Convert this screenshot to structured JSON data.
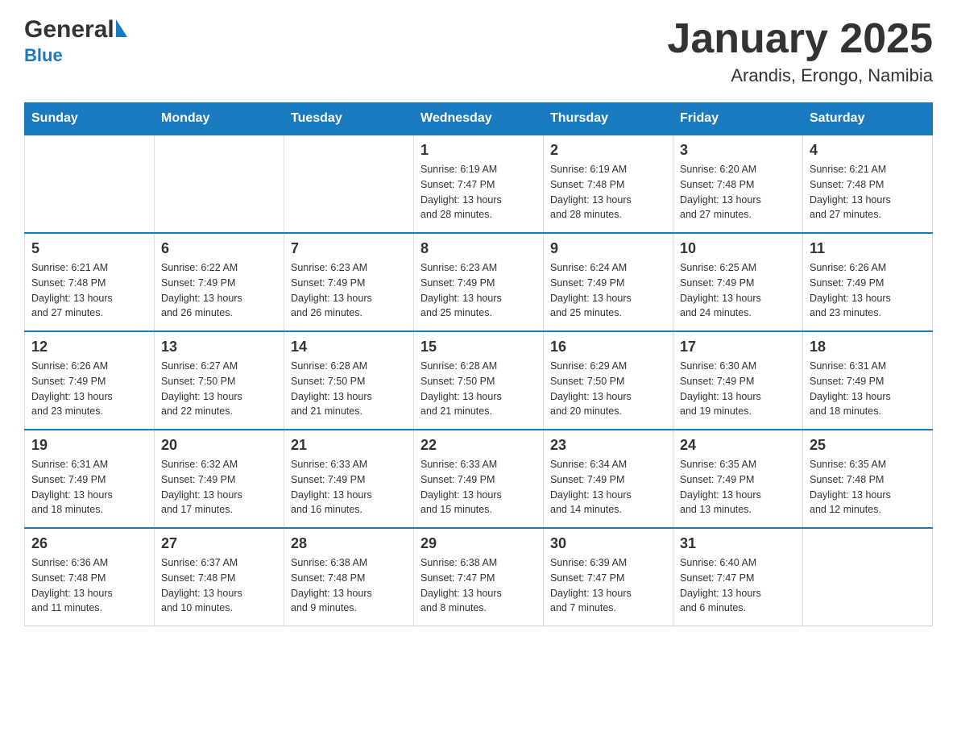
{
  "header": {
    "logo_general": "General",
    "logo_blue": "Blue",
    "title": "January 2025",
    "subtitle": "Arandis, Erongo, Namibia"
  },
  "columns": [
    "Sunday",
    "Monday",
    "Tuesday",
    "Wednesday",
    "Thursday",
    "Friday",
    "Saturday"
  ],
  "rows": [
    [
      {
        "day": "",
        "info": ""
      },
      {
        "day": "",
        "info": ""
      },
      {
        "day": "",
        "info": ""
      },
      {
        "day": "1",
        "info": "Sunrise: 6:19 AM\nSunset: 7:47 PM\nDaylight: 13 hours\nand 28 minutes."
      },
      {
        "day": "2",
        "info": "Sunrise: 6:19 AM\nSunset: 7:48 PM\nDaylight: 13 hours\nand 28 minutes."
      },
      {
        "day": "3",
        "info": "Sunrise: 6:20 AM\nSunset: 7:48 PM\nDaylight: 13 hours\nand 27 minutes."
      },
      {
        "day": "4",
        "info": "Sunrise: 6:21 AM\nSunset: 7:48 PM\nDaylight: 13 hours\nand 27 minutes."
      }
    ],
    [
      {
        "day": "5",
        "info": "Sunrise: 6:21 AM\nSunset: 7:48 PM\nDaylight: 13 hours\nand 27 minutes."
      },
      {
        "day": "6",
        "info": "Sunrise: 6:22 AM\nSunset: 7:49 PM\nDaylight: 13 hours\nand 26 minutes."
      },
      {
        "day": "7",
        "info": "Sunrise: 6:23 AM\nSunset: 7:49 PM\nDaylight: 13 hours\nand 26 minutes."
      },
      {
        "day": "8",
        "info": "Sunrise: 6:23 AM\nSunset: 7:49 PM\nDaylight: 13 hours\nand 25 minutes."
      },
      {
        "day": "9",
        "info": "Sunrise: 6:24 AM\nSunset: 7:49 PM\nDaylight: 13 hours\nand 25 minutes."
      },
      {
        "day": "10",
        "info": "Sunrise: 6:25 AM\nSunset: 7:49 PM\nDaylight: 13 hours\nand 24 minutes."
      },
      {
        "day": "11",
        "info": "Sunrise: 6:26 AM\nSunset: 7:49 PM\nDaylight: 13 hours\nand 23 minutes."
      }
    ],
    [
      {
        "day": "12",
        "info": "Sunrise: 6:26 AM\nSunset: 7:49 PM\nDaylight: 13 hours\nand 23 minutes."
      },
      {
        "day": "13",
        "info": "Sunrise: 6:27 AM\nSunset: 7:50 PM\nDaylight: 13 hours\nand 22 minutes."
      },
      {
        "day": "14",
        "info": "Sunrise: 6:28 AM\nSunset: 7:50 PM\nDaylight: 13 hours\nand 21 minutes."
      },
      {
        "day": "15",
        "info": "Sunrise: 6:28 AM\nSunset: 7:50 PM\nDaylight: 13 hours\nand 21 minutes."
      },
      {
        "day": "16",
        "info": "Sunrise: 6:29 AM\nSunset: 7:50 PM\nDaylight: 13 hours\nand 20 minutes."
      },
      {
        "day": "17",
        "info": "Sunrise: 6:30 AM\nSunset: 7:49 PM\nDaylight: 13 hours\nand 19 minutes."
      },
      {
        "day": "18",
        "info": "Sunrise: 6:31 AM\nSunset: 7:49 PM\nDaylight: 13 hours\nand 18 minutes."
      }
    ],
    [
      {
        "day": "19",
        "info": "Sunrise: 6:31 AM\nSunset: 7:49 PM\nDaylight: 13 hours\nand 18 minutes."
      },
      {
        "day": "20",
        "info": "Sunrise: 6:32 AM\nSunset: 7:49 PM\nDaylight: 13 hours\nand 17 minutes."
      },
      {
        "day": "21",
        "info": "Sunrise: 6:33 AM\nSunset: 7:49 PM\nDaylight: 13 hours\nand 16 minutes."
      },
      {
        "day": "22",
        "info": "Sunrise: 6:33 AM\nSunset: 7:49 PM\nDaylight: 13 hours\nand 15 minutes."
      },
      {
        "day": "23",
        "info": "Sunrise: 6:34 AM\nSunset: 7:49 PM\nDaylight: 13 hours\nand 14 minutes."
      },
      {
        "day": "24",
        "info": "Sunrise: 6:35 AM\nSunset: 7:49 PM\nDaylight: 13 hours\nand 13 minutes."
      },
      {
        "day": "25",
        "info": "Sunrise: 6:35 AM\nSunset: 7:48 PM\nDaylight: 13 hours\nand 12 minutes."
      }
    ],
    [
      {
        "day": "26",
        "info": "Sunrise: 6:36 AM\nSunset: 7:48 PM\nDaylight: 13 hours\nand 11 minutes."
      },
      {
        "day": "27",
        "info": "Sunrise: 6:37 AM\nSunset: 7:48 PM\nDaylight: 13 hours\nand 10 minutes."
      },
      {
        "day": "28",
        "info": "Sunrise: 6:38 AM\nSunset: 7:48 PM\nDaylight: 13 hours\nand 9 minutes."
      },
      {
        "day": "29",
        "info": "Sunrise: 6:38 AM\nSunset: 7:47 PM\nDaylight: 13 hours\nand 8 minutes."
      },
      {
        "day": "30",
        "info": "Sunrise: 6:39 AM\nSunset: 7:47 PM\nDaylight: 13 hours\nand 7 minutes."
      },
      {
        "day": "31",
        "info": "Sunrise: 6:40 AM\nSunset: 7:47 PM\nDaylight: 13 hours\nand 6 minutes."
      },
      {
        "day": "",
        "info": ""
      }
    ]
  ]
}
